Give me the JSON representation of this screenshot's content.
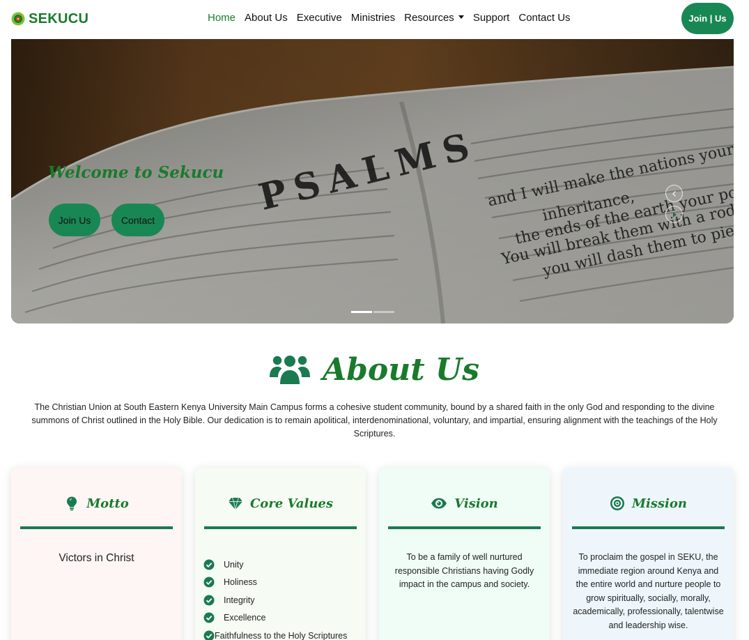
{
  "brand": {
    "name": "SEKUCU"
  },
  "nav": {
    "items": [
      {
        "label": "Home",
        "active": true
      },
      {
        "label": "About Us"
      },
      {
        "label": "Executive"
      },
      {
        "label": "Ministries"
      },
      {
        "label": "Resources",
        "dropdown": true
      },
      {
        "label": "Support"
      },
      {
        "label": "Contact Us"
      }
    ],
    "join_label": "Join | Us"
  },
  "hero": {
    "title": "Welcome to Sekucu",
    "join_label": "Join Us",
    "contact_label": "Contact",
    "slides_total": 2,
    "active_slide": 1
  },
  "about": {
    "title": "About Us",
    "text": "The Christian Union at South Eastern Kenya University Main Campus forms a cohesive student community, bound by a shared faith in the only God and responding to the divine summons of Christ outlined in the Holy Bible. Our dedication is to remain apolitical, interdenominational, voluntary, and impartial, ensuring alignment with the teachings of the Holy Scriptures."
  },
  "cards": {
    "motto": {
      "title": "Motto",
      "icon": "lightbulb-icon",
      "text": "Victors in Christ"
    },
    "core_values": {
      "title": "Core Values",
      "icon": "gem-icon",
      "items": [
        "Unity",
        "Holiness",
        "Integrity",
        "Excellence",
        "Faithfulness to the Holy Scriptures"
      ]
    },
    "vision": {
      "title": "Vision",
      "icon": "eye-icon",
      "text": "To be a family of well nurtured responsible Christians having Godly impact in the campus and society."
    },
    "mission": {
      "title": "Mission",
      "icon": "target-icon",
      "text": "To proclaim the gospel in SEKU, the immediate region around Kenya and the entire world and nurture people to grow spiritually, socially, morally, academically, professionally, talentwise and leadership wise."
    }
  },
  "colors": {
    "brand_green": "#1a7a2c",
    "button_green": "#198754",
    "rule_green": "#1a7a50"
  }
}
